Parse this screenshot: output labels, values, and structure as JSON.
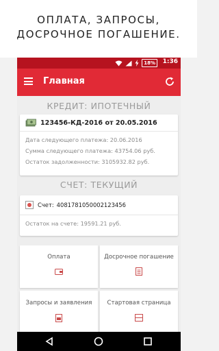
{
  "promo": {
    "line1": "ОПЛАТА, ЗАПРОСЫ,",
    "line2": "ДОСРОЧНОЕ ПОГАШЕНИЕ."
  },
  "status_bar": {
    "battery": "18%",
    "time": "1:36"
  },
  "app_bar": {
    "title": "Главная",
    "menu_icon": "hamburger-icon",
    "refresh_icon": "refresh-icon"
  },
  "credit": {
    "section_title": "КРЕДИТ: ИПОТЕЧНЫЙ",
    "contract": "123456-КД-2016 от 20.05.2016",
    "rows": [
      "Дата следующего платежа: 20.06.2016",
      "Сумма следующего платежа: 43754.06 руб.",
      "Остаток задолженности: 3105932.82 руб."
    ]
  },
  "account": {
    "section_title": "СЧЕТ: ТЕКУЩИЙ",
    "account_label": "Счет:",
    "account_number": "40817810500021234​56",
    "balance": "Остаток на счете:      19591.21 руб."
  },
  "tiles": [
    {
      "label": "Оплата",
      "icon": "wallet-icon"
    },
    {
      "label": "Досрочное погашение",
      "icon": "document-icon"
    },
    {
      "label": "Запросы и заявления",
      "icon": "pdf-icon"
    },
    {
      "label": "Стартовая страница",
      "icon": "page-icon"
    }
  ],
  "colors": {
    "status_bar": "#b6131f",
    "app_bar": "#e12a36",
    "background": "#eeeeee"
  }
}
